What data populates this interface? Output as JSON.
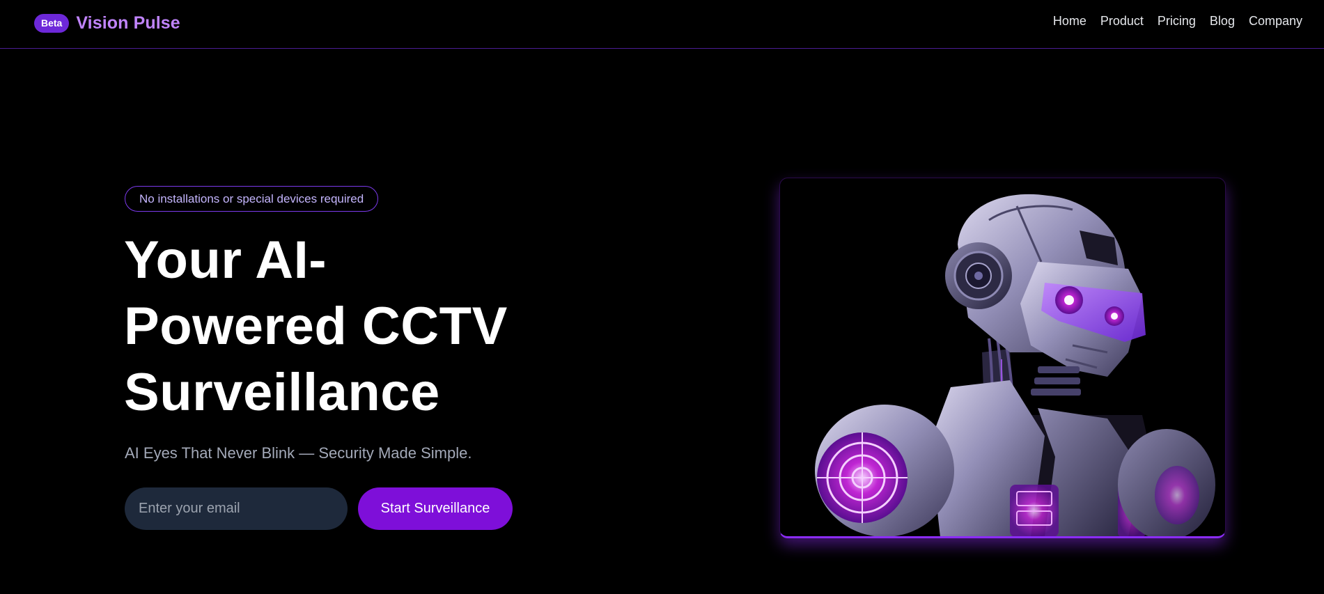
{
  "navbar": {
    "badge": "Beta",
    "brand": "Vision Pulse",
    "links": [
      "Home",
      "Product",
      "Pricing",
      "Blog",
      "Company"
    ]
  },
  "hero": {
    "tagline": "No installations or special devices required",
    "headline_lines": [
      "Your AI-",
      "Powered CCTV",
      "Surveillance"
    ],
    "subheadline": "AI Eyes That Never Blink — Security Made Simple.",
    "email_placeholder": "Enter your email",
    "cta_label": "Start Surveillance"
  },
  "colors": {
    "background": "#000000",
    "accent": "#7e0fd9",
    "brand_text": "#c084fc",
    "input_bg": "#1e293b",
    "divider": "#4c1d95"
  },
  "icons": {
    "hero_image": "robot-illustration"
  }
}
